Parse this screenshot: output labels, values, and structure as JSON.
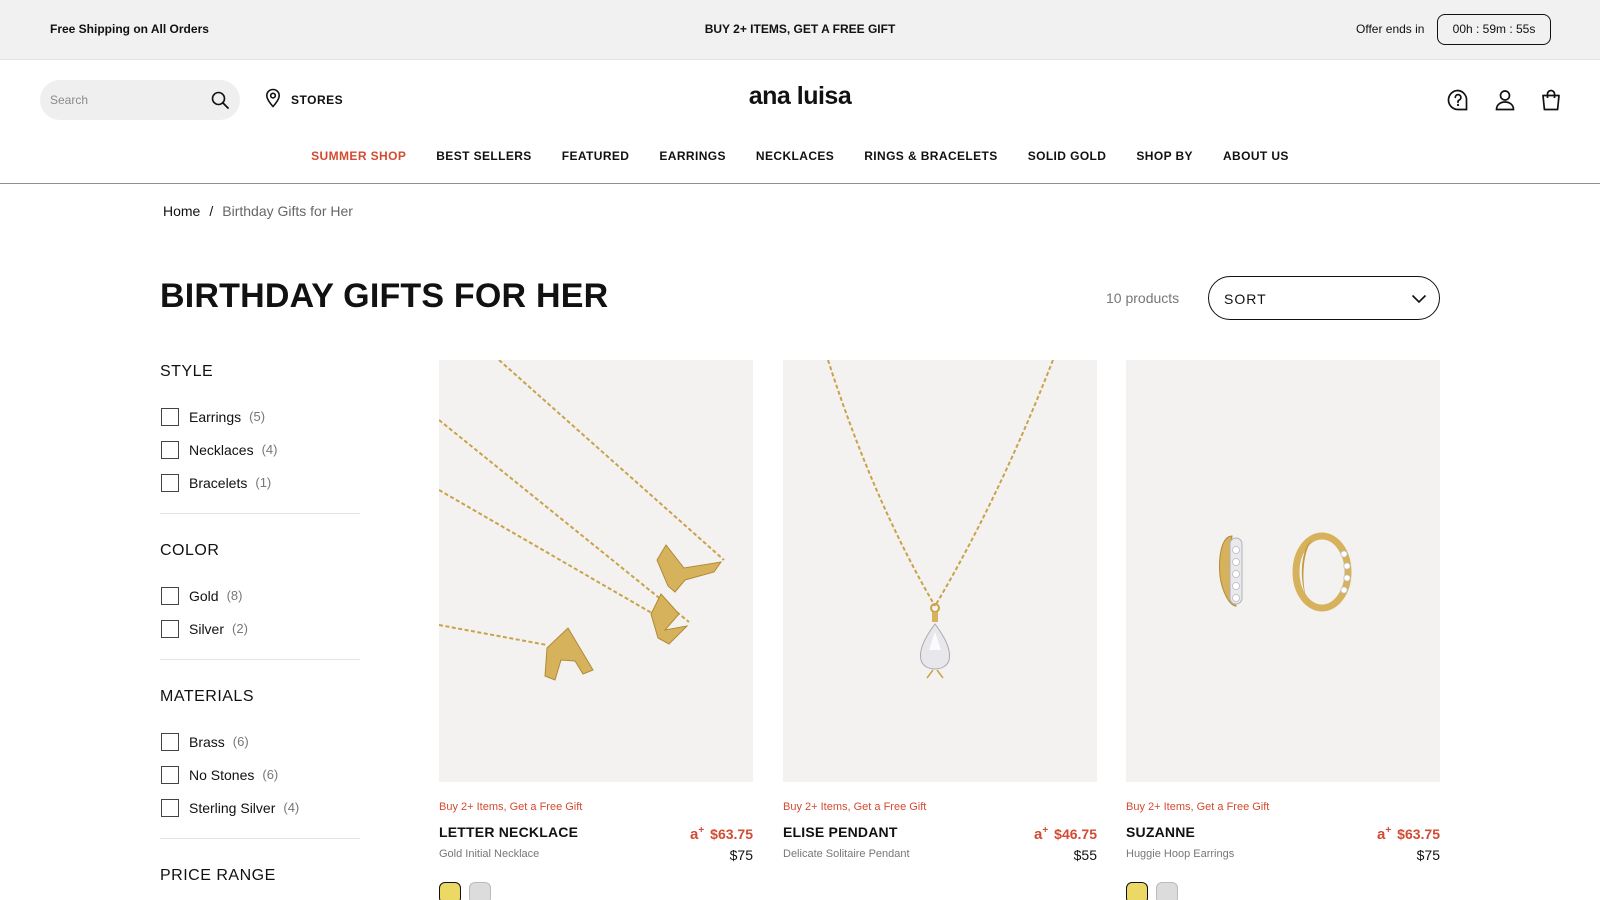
{
  "announcement": {
    "left_text": "Free Shipping on All Orders",
    "center_text": "BUY 2+ ITEMS, GET A FREE GIFT",
    "offer_label": "Offer ends in",
    "timer": "00h : 59m : 55s"
  },
  "header": {
    "search_placeholder": "Search",
    "stores_label": "STORES",
    "logo": "ana luisa",
    "icons": [
      "help-icon",
      "account-icon",
      "cart-icon"
    ]
  },
  "nav": {
    "items": [
      "SUMMER SHOP",
      "BEST SELLERS",
      "FEATURED",
      "EARRINGS",
      "NECKLACES",
      "RINGS & BRACELETS",
      "SOLID GOLD",
      "SHOP BY",
      "ABOUT US"
    ],
    "accent_color": "#d24b32"
  },
  "breadcrumb": {
    "home": "Home",
    "separator": "/",
    "current": "Birthday Gifts for Her"
  },
  "page": {
    "title": "BIRTHDAY GIFTS FOR HER",
    "product_count": "10 products",
    "sort_label": "SORT"
  },
  "filters": [
    {
      "title": "STYLE",
      "options": [
        {
          "name": "Earrings",
          "count": "(5)"
        },
        {
          "name": "Necklaces",
          "count": "(4)"
        },
        {
          "name": "Bracelets",
          "count": "(1)"
        }
      ]
    },
    {
      "title": "COLOR",
      "options": [
        {
          "name": "Gold",
          "count": "(8)"
        },
        {
          "name": "Silver",
          "count": "(2)"
        }
      ]
    },
    {
      "title": "MATERIALS",
      "options": [
        {
          "name": "Brass",
          "count": "(6)"
        },
        {
          "name": "No Stones",
          "count": "(6)"
        },
        {
          "name": "Sterling Silver",
          "count": "(4)"
        }
      ]
    },
    {
      "title": "PRICE RANGE",
      "options": []
    }
  ],
  "products": [
    {
      "promo": "Buy 2+ Items, Get a Free Gift",
      "name": "LETTER NECKLACE",
      "subtitle": "Gold Initial Necklace",
      "badge": "a",
      "sale_price": "$63.75",
      "price": "$75",
      "image": "letter-necklace-image",
      "swatches": [
        "gold",
        "silver"
      ]
    },
    {
      "promo": "Buy 2+ Items, Get a Free Gift",
      "name": "ELISE PENDANT",
      "subtitle": "Delicate Solitaire Pendant",
      "badge": "a",
      "sale_price": "$46.75",
      "price": "$55",
      "image": "pendant-necklace-image",
      "swatches": []
    },
    {
      "promo": "Buy 2+ Items, Get a Free Gift",
      "name": "SUZANNE",
      "subtitle": "Huggie Hoop Earrings",
      "badge": "a",
      "sale_price": "$63.75",
      "price": "$75",
      "image": "hoop-earrings-image",
      "swatches": [
        "gold",
        "silver"
      ]
    }
  ],
  "colors": {
    "sale": "#d24b32",
    "image_background": "#f4f2f1",
    "gold_swatch": "#ecd864",
    "silver_swatch": "#dcdcdc"
  }
}
